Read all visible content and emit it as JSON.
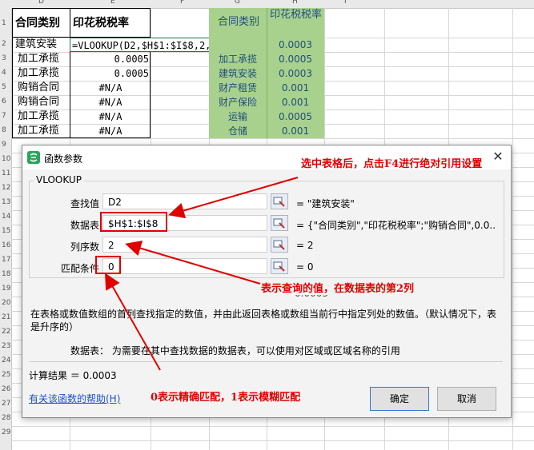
{
  "sheet": {
    "col_headers": [
      "D",
      "E",
      "F",
      "G",
      "H",
      "I"
    ],
    "row_numbers": [
      "1",
      "2",
      "3",
      "4",
      "5",
      "6",
      "7",
      "8",
      "9",
      "10",
      "11",
      "12",
      "13",
      "14",
      "15",
      "16",
      "17",
      "18",
      "19",
      "20",
      "21",
      "22",
      "23",
      "24",
      "25",
      "26",
      "27",
      "28",
      "29"
    ],
    "left_table": {
      "header_a": "合同类别",
      "header_b": "印花税税率",
      "rows": [
        {
          "a": "建筑安装",
          "b": "=VLOOKUP(D2,$H$1:$I$8,2,0)"
        },
        {
          "a": "加工承揽",
          "b": "0.0005"
        },
        {
          "a": "加工承揽",
          "b": "0.0005"
        },
        {
          "a": "购销合同",
          "b": "#N/A"
        },
        {
          "a": "购销合同",
          "b": "#N/A"
        },
        {
          "a": "加工承揽",
          "b": "#N/A"
        },
        {
          "a": "加工承揽",
          "b": "#N/A"
        }
      ]
    },
    "right_table": {
      "header_a": "合同类别",
      "header_b": "印花税税率",
      "rows": [
        {
          "a": "",
          "b": "0.0003"
        },
        {
          "a": "加工承揽",
          "b": "0.0005"
        },
        {
          "a": "建筑安装",
          "b": "0.0003"
        },
        {
          "a": "财产租赁",
          "b": "0.001"
        },
        {
          "a": "财产保险",
          "b": "0.001"
        },
        {
          "a": "运输",
          "b": "0.0005"
        },
        {
          "a": "仓储",
          "b": "0.001"
        }
      ]
    },
    "partial_value": "0.0003"
  },
  "dialog": {
    "title": "函数参数",
    "function_name": "VLOOKUP",
    "args": [
      {
        "label": "查找值",
        "value": "D2",
        "result": "= \"建筑安装\""
      },
      {
        "label": "数据表",
        "value": "$H$1:$I$8",
        "result": "= {\"合同类别\",\"印花税税率\";\"购销合同\",0.0..."
      },
      {
        "label": "列序数",
        "value": "2",
        "result": "= 2"
      },
      {
        "label": "匹配条件",
        "value": "0",
        "result": "= 0"
      }
    ],
    "description": "在表格或数值数组的首列查找指定的数值，并由此返回表格或数组当前行中指定列处的数值。（默认情况下，表是升序的）",
    "param_desc": "数据表：  为需要在其中查找数据的数据表，可以使用对区域或区域名称的引用",
    "calc_result": "计算结果 ＝ 0.0003",
    "help_link": "有关该函数的帮助(H)",
    "ok_label": "确定",
    "cancel_label": "取消"
  },
  "annotations": {
    "note1": "选中表格后，点击F4进行绝对引用设置",
    "note2": "表示查询的值，在数据表的第2列",
    "note3": "0表示精确匹配，1表示模糊匹配"
  },
  "colors": {
    "annotation": "#e00000",
    "lookup_fill": "#a9d18e"
  }
}
